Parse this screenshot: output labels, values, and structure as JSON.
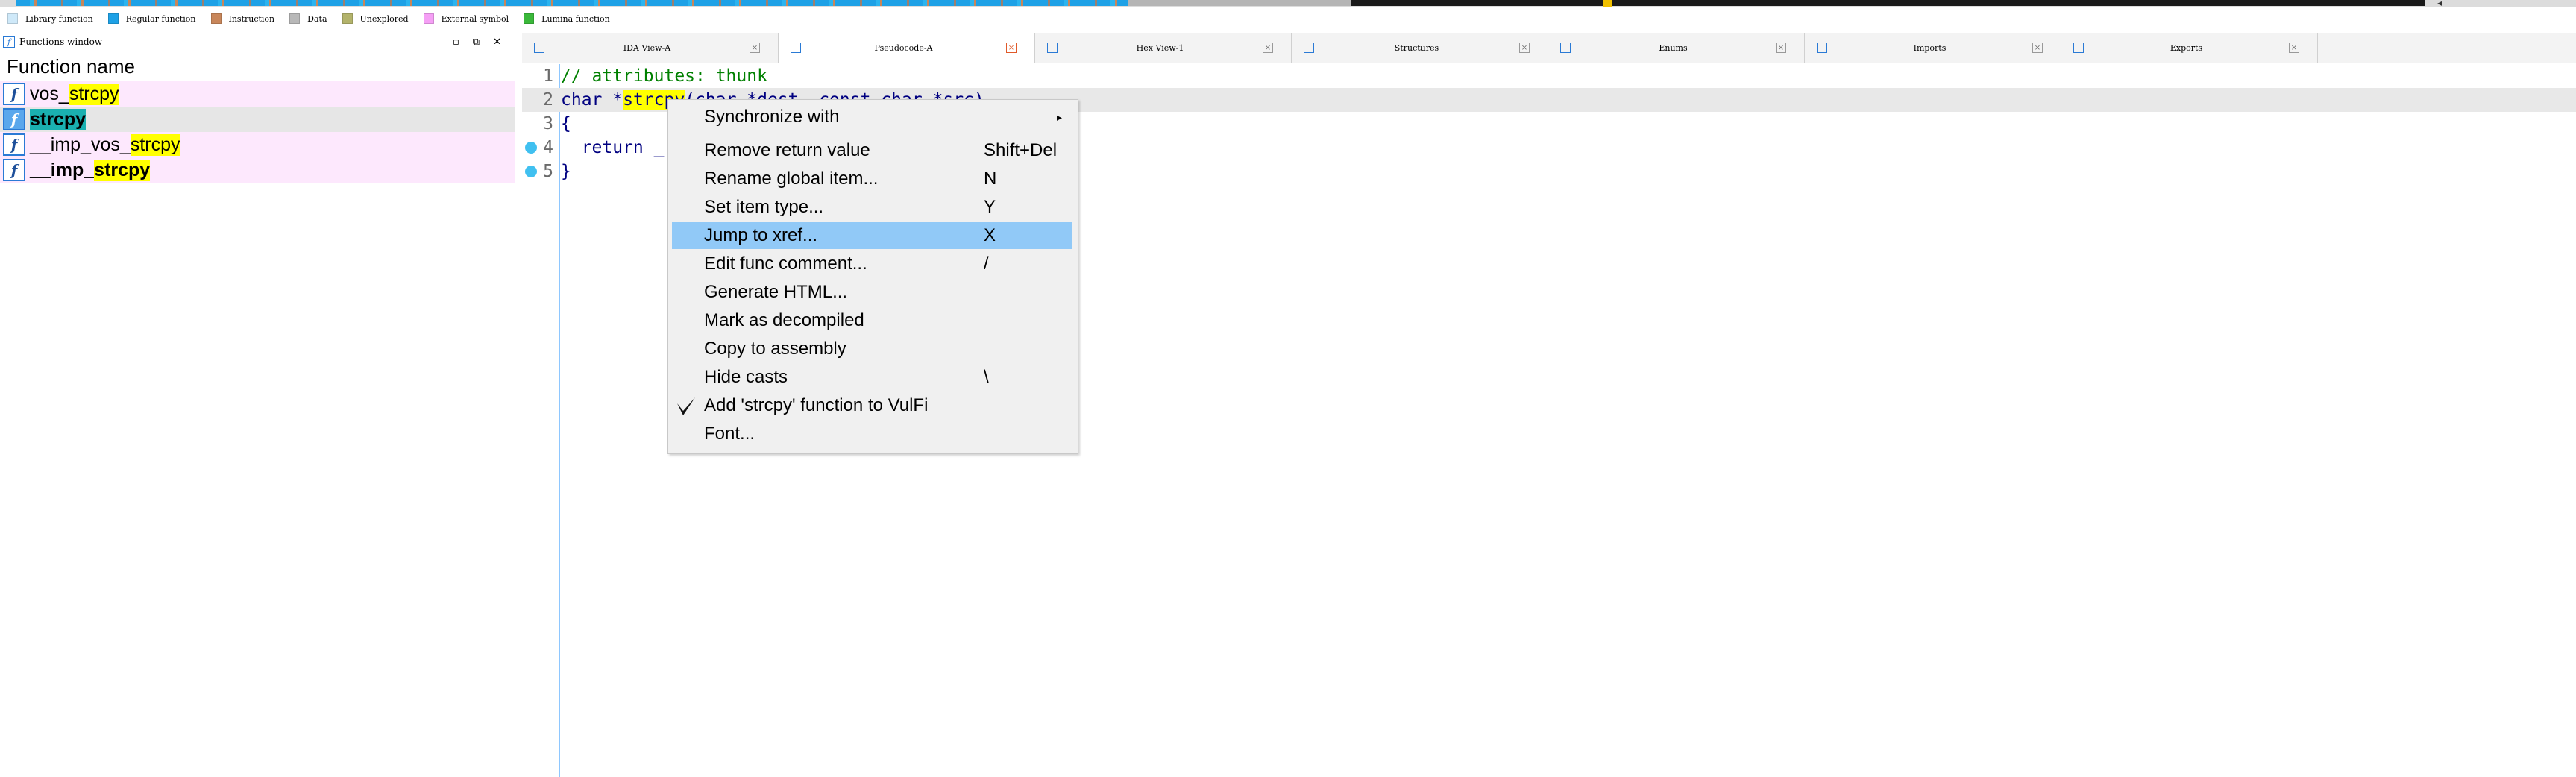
{
  "legend": [
    {
      "label": "Library function",
      "color": "#cfe9f9"
    },
    {
      "label": "Regular function",
      "color": "#1ea1e6"
    },
    {
      "label": "Instruction",
      "color": "#c8865a"
    },
    {
      "label": "Data",
      "color": "#b8b8b8"
    },
    {
      "label": "Unexplored",
      "color": "#b3b36b"
    },
    {
      "label": "External symbol",
      "color": "#f59ff5"
    },
    {
      "label": "Lumina function",
      "color": "#3ab83a"
    }
  ],
  "functions_window": {
    "title": "Functions window",
    "column_header": "Function name",
    "rows": [
      {
        "prefix": "vos_",
        "match": "strcpy",
        "suffix": ""
      },
      {
        "prefix": "",
        "match": "strcpy",
        "suffix": ""
      },
      {
        "prefix": "__imp_vos_",
        "match": "strcpy",
        "suffix": ""
      },
      {
        "prefix": "__imp_",
        "match": "strcpy",
        "suffix": ""
      }
    ]
  },
  "tabs": [
    "IDA View-A",
    "Pseudocode-A",
    "Hex View-1",
    "Structures",
    "Enums",
    "Imports",
    "Exports"
  ],
  "pseudocode": {
    "lines": [
      {
        "num": "1",
        "text": "// attributes: thunk"
      },
      {
        "num": "2",
        "pre": "char *",
        "hl": "strcpy",
        "post": "(char *dest, const char *src)"
      },
      {
        "num": "3",
        "text": "{"
      },
      {
        "num": "4",
        "text": "  return _"
      },
      {
        "num": "5",
        "text": "}"
      }
    ]
  },
  "context_menu": {
    "items": [
      {
        "label": "Synchronize with",
        "shortcut": ""
      },
      {
        "label": "Remove return value",
        "shortcut": "Shift+Del"
      },
      {
        "label": "Rename global item...",
        "shortcut": "N"
      },
      {
        "label": "Set item type...",
        "shortcut": "Y"
      },
      {
        "label": "Jump to xref...",
        "shortcut": "X"
      },
      {
        "label": "Edit func comment...",
        "shortcut": "/"
      },
      {
        "label": "Generate HTML...",
        "shortcut": ""
      },
      {
        "label": "Mark as decompiled",
        "shortcut": ""
      },
      {
        "label": "Copy to assembly",
        "shortcut": ""
      },
      {
        "label": "Hide casts",
        "shortcut": "\\"
      },
      {
        "label": "Add 'strcpy' function to VulFi",
        "shortcut": ""
      },
      {
        "label": "Font...",
        "shortcut": ""
      }
    ]
  }
}
